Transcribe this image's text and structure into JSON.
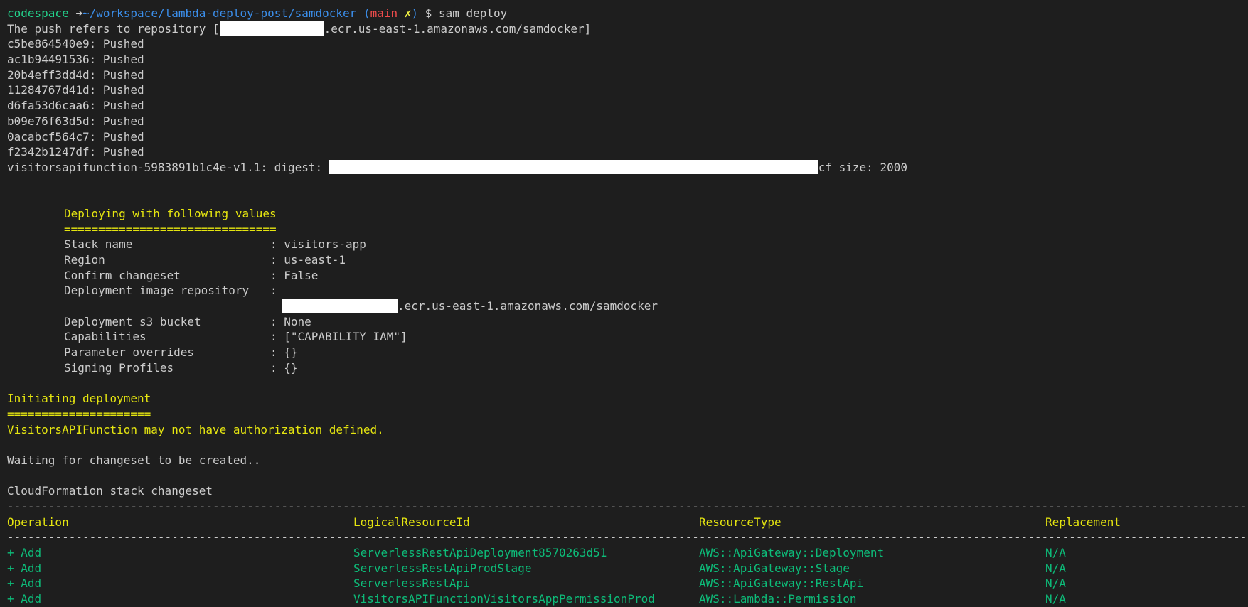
{
  "prompt": {
    "user": "codespace",
    "arrow": "➜",
    "path": "~/workspace/lambda-deploy-post/samdocker",
    "branch_open": "(",
    "branch": "main",
    "dirty_mark": "✗",
    "branch_close": ")",
    "dollar": "$",
    "command": "sam deploy"
  },
  "push": {
    "intro_prefix": "The push refers to repository [",
    "intro_suffix": ".ecr.us-east-1.amazonaws.com/samdocker]",
    "layers": [
      {
        "id": "c5be864540e9",
        "status": "Pushed"
      },
      {
        "id": "ac1b94491536",
        "status": "Pushed"
      },
      {
        "id": "20b4eff3dd4d",
        "status": "Pushed"
      },
      {
        "id": "11284767d41d",
        "status": "Pushed"
      },
      {
        "id": "d6fa53d6caa6",
        "status": "Pushed"
      },
      {
        "id": "b09e76f63d5d",
        "status": "Pushed"
      },
      {
        "id": "0acabcf564c7",
        "status": "Pushed"
      },
      {
        "id": "f2342b1247df",
        "status": "Pushed"
      }
    ],
    "digest_prefix": "visitorsapifunction-5983891b1c4e-v1.1: digest: ",
    "digest_suffix": "cf size: 2000"
  },
  "deploy": {
    "heading": "Deploying with following values",
    "underline": "===============================",
    "rows": [
      {
        "key": "Stack name",
        "value": ": visitors-app"
      },
      {
        "key": "Region",
        "value": ": us-east-1"
      },
      {
        "key": "Confirm changeset",
        "value": ": False"
      },
      {
        "key": "Deployment image repository",
        "value": ":"
      }
    ],
    "repo_suffix": ".ecr.us-east-1.amazonaws.com/samdocker",
    "rows2": [
      {
        "key": "Deployment s3 bucket",
        "value": ": None"
      },
      {
        "key": "Capabilities",
        "value": ": [\"CAPABILITY_IAM\"]"
      },
      {
        "key": "Parameter overrides",
        "value": ": {}"
      },
      {
        "key": "Signing Profiles",
        "value": ": {}"
      }
    ]
  },
  "initiating": {
    "heading": "Initiating deployment",
    "underline": "=====================",
    "warning": "VisitorsAPIFunction may not have authorization defined.",
    "waiting": "Waiting for changeset to be created..",
    "changeset_title": "CloudFormation stack changeset"
  },
  "table": {
    "separator": "----------------------------------------------------------------------------------------------------------------------------------------------------------------------------------------------",
    "headers": [
      "Operation",
      "LogicalResourceId",
      "ResourceType",
      "Replacement"
    ],
    "rows": [
      [
        "+ Add",
        "ServerlessRestApiDeployment8570263d51",
        "AWS::ApiGateway::Deployment",
        "N/A"
      ],
      [
        "+ Add",
        "ServerlessRestApiProdStage",
        "AWS::ApiGateway::Stage",
        "N/A"
      ],
      [
        "+ Add",
        "ServerlessRestApi",
        "AWS::ApiGateway::RestApi",
        "N/A"
      ],
      [
        "+ Add",
        "VisitorsAPIFunctionVisitorsAppPermissionProd",
        "AWS::Lambda::Permission",
        "N/A"
      ]
    ]
  },
  "colors": {
    "background": "#1e1e1e",
    "text": "#cccccc",
    "green": "#23d18b",
    "blue": "#3b8eea",
    "red": "#f14c4c",
    "yellow": "#e5e510",
    "table_green": "#0dbc79"
  }
}
